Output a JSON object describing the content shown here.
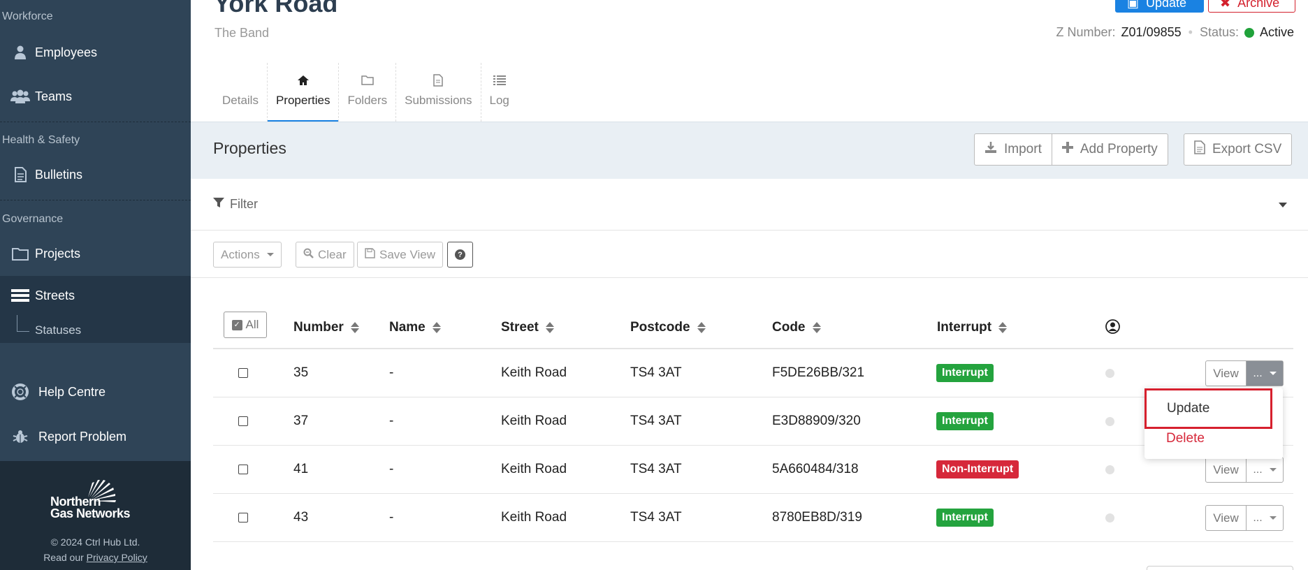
{
  "sidebar": {
    "sections": [
      "Workforce",
      "Health & Safety",
      "Governance"
    ],
    "items": {
      "employees": "Employees",
      "teams": "Teams",
      "bulletins": "Bulletins",
      "projects": "Projects",
      "streets": "Streets",
      "statuses": "Statuses",
      "help": "Help Centre",
      "report": "Report Problem"
    },
    "logo_line1": "Northern",
    "logo_line2": "Gas Networks",
    "copyright": "© 2024 Ctrl Hub Ltd.",
    "privacy_prefix": "Read our ",
    "privacy_link": "Privacy Policy"
  },
  "header": {
    "title": "York Road",
    "subtitle": "The Band",
    "update_label": "Update",
    "archive_label": "Archive",
    "z_label": "Z Number:",
    "z_value": "Z01/09855",
    "status_label": "Status:",
    "status_value": "Active",
    "status_color": "#20a23a"
  },
  "tabs": [
    "Details",
    "Properties",
    "Folders",
    "Submissions",
    "Log"
  ],
  "panel": {
    "title": "Properties",
    "import_label": "Import",
    "add_label": "Add Property",
    "export_label": "Export CSV",
    "filter_label": "Filter",
    "actions_label": "Actions",
    "clear_label": "Clear",
    "save_view_label": "Save View",
    "help_label": "?"
  },
  "table": {
    "all_label": "All",
    "columns": [
      "Number",
      "Name",
      "Street",
      "Postcode",
      "Code",
      "Interrupt"
    ],
    "rows": [
      {
        "number": "35",
        "name": "-",
        "street": "Keith Road",
        "postcode": "TS4 3AT",
        "code": "F5DE26BB/321",
        "interrupt": "Interrupt"
      },
      {
        "number": "37",
        "name": "-",
        "street": "Keith Road",
        "postcode": "TS4 3AT",
        "code": "E3D88909/320",
        "interrupt": "Interrupt"
      },
      {
        "number": "41",
        "name": "-",
        "street": "Keith Road",
        "postcode": "TS4 3AT",
        "code": "5A660484/318",
        "interrupt": "Non-Interrupt"
      },
      {
        "number": "43",
        "name": "-",
        "street": "Keith Road",
        "postcode": "TS4 3AT",
        "code": "8780EB8D/319",
        "interrupt": "Interrupt"
      }
    ],
    "view_label": "View",
    "more_label": "..."
  },
  "dropdown": {
    "update_label": "Update",
    "delete_label": "Delete"
  },
  "colors": {
    "sidebar": "#2f4457",
    "accent": "#1a82e2",
    "interrupt": "#24a33e",
    "non_interrupt": "#d6283a",
    "highlight": "#d6202e"
  }
}
